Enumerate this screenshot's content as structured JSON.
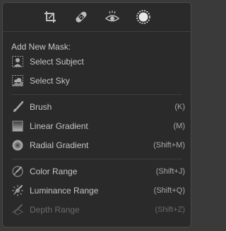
{
  "toolbar": {
    "tools": [
      {
        "name": "crop-tool-icon"
      },
      {
        "name": "healing-tool-icon"
      },
      {
        "name": "redeye-tool-icon"
      },
      {
        "name": "masking-tool-icon",
        "selected": true
      }
    ]
  },
  "menu": {
    "heading": "Add New Mask:",
    "ai_items": [
      {
        "label": "Select Subject",
        "icon": "select-subject-icon"
      },
      {
        "label": "Select Sky",
        "icon": "select-sky-icon"
      }
    ],
    "draw_items": [
      {
        "label": "Brush",
        "shortcut": "(K)",
        "icon": "brush-icon"
      },
      {
        "label": "Linear Gradient",
        "shortcut": "(M)",
        "icon": "linear-gradient-icon"
      },
      {
        "label": "Radial Gradient",
        "shortcut": "(Shift+M)",
        "icon": "radial-gradient-icon"
      }
    ],
    "range_items": [
      {
        "label": "Color Range",
        "shortcut": "(Shift+J)",
        "icon": "color-range-icon"
      },
      {
        "label": "Luminance Range",
        "shortcut": "(Shift+Q)",
        "icon": "luminance-range-icon"
      },
      {
        "label": "Depth Range",
        "shortcut": "(Shift+Z)",
        "icon": "depth-range-icon",
        "disabled": true
      }
    ]
  },
  "colors": {
    "panel_bg": "#2a2a2a",
    "text": "#c4c4c4",
    "disabled_text": "#6a6a6a"
  }
}
